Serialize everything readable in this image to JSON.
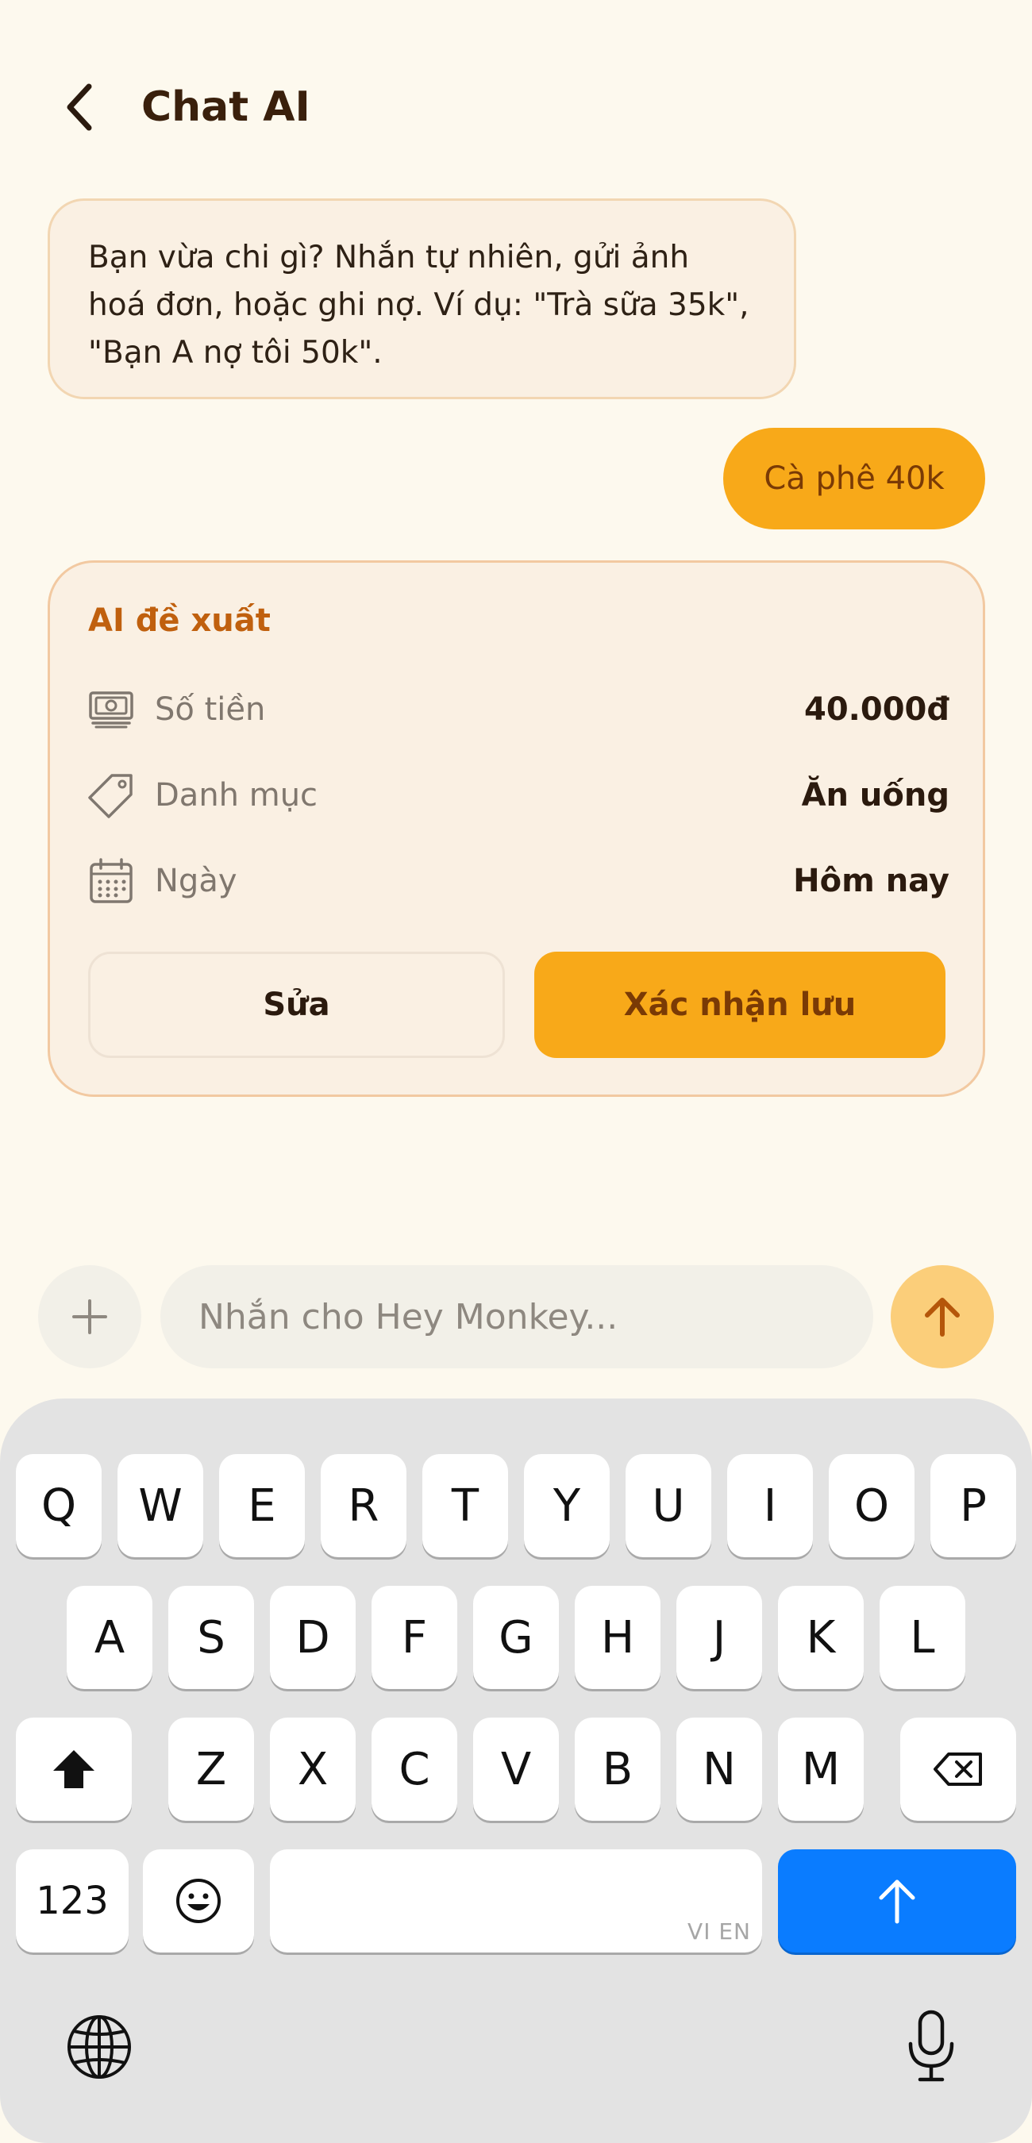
{
  "header": {
    "title": "Chat AI"
  },
  "messages": {
    "assistant_prompt": "Bạn vừa chi gì? Nhắn tự nhiên, gửi ảnh hoá đơn, hoặc ghi nợ. Ví dụ: \"Trà sữa 35k\", \"Bạn A nợ tôi 50k\".",
    "user_message": "Cà phê 40k"
  },
  "suggestion": {
    "title": "AI đề xuất",
    "rows": [
      {
        "icon": "money-icon",
        "label": "Số tiền",
        "value": "40.000đ"
      },
      {
        "icon": "tag-icon",
        "label": "Danh mục",
        "value": "Ăn uống"
      },
      {
        "icon": "calendar-icon",
        "label": "Ngày",
        "value": "Hôm nay"
      }
    ],
    "edit_label": "Sửa",
    "confirm_label": "Xác nhận lưu"
  },
  "composer": {
    "placeholder": "Nhắn cho Hey Monkey..."
  },
  "keyboard": {
    "row1": [
      "Q",
      "W",
      "E",
      "R",
      "T",
      "Y",
      "U",
      "I",
      "O",
      "P"
    ],
    "row2": [
      "A",
      "S",
      "D",
      "F",
      "G",
      "H",
      "J",
      "K",
      "L"
    ],
    "row3": [
      "Z",
      "X",
      "C",
      "V",
      "B",
      "N",
      "M"
    ],
    "numbers_label": "123",
    "space_hint": "VI EN"
  },
  "colors": {
    "accent": "#F8A919",
    "accent_text": "#7A3A05",
    "background": "#FDF9EE",
    "card": "#FAF0E3",
    "keyboard_blue": "#0A7CFF"
  }
}
